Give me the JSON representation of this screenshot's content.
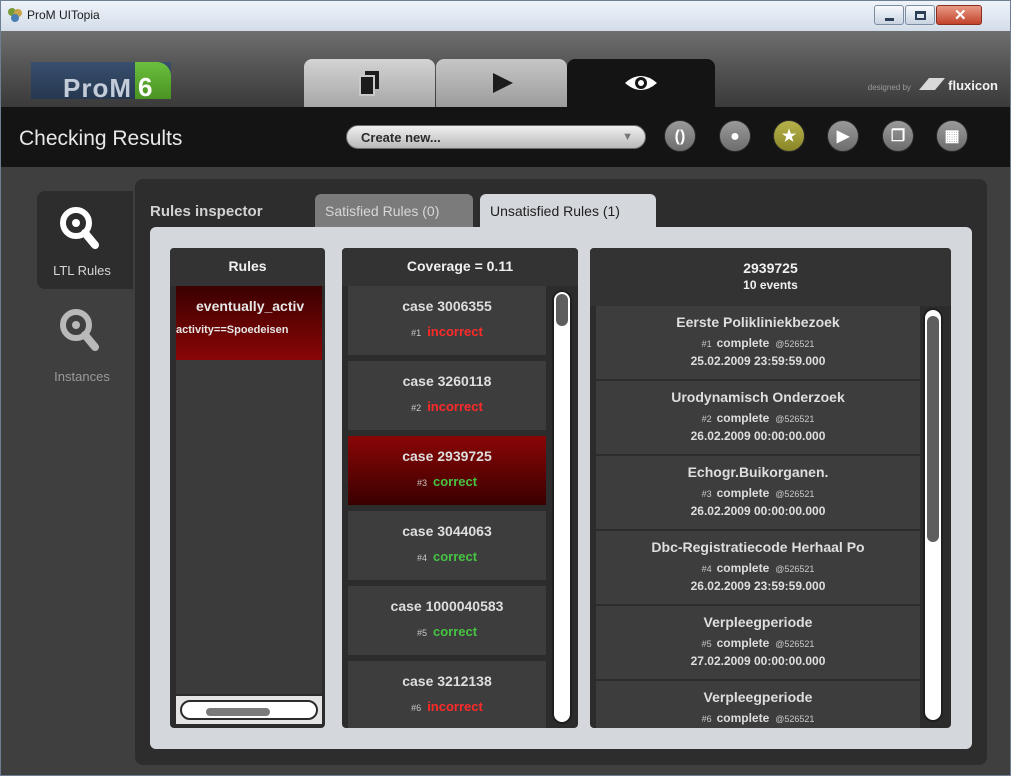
{
  "window": {
    "title": "ProM UITopia"
  },
  "brand": {
    "logo_word": "ProM",
    "logo_version": "6",
    "designed_by": "designed by",
    "vendor": "fluxicon"
  },
  "header": {
    "title": "Checking Results",
    "create_select": "Create new..."
  },
  "sidebar": {
    "items": [
      {
        "label": "LTL Rules"
      },
      {
        "label": "Instances"
      }
    ]
  },
  "inspector": {
    "title": "Rules inspector",
    "tabs": [
      {
        "label": "Satisfied Rules (0)"
      },
      {
        "label": "Unsatisfied Rules (1)"
      }
    ]
  },
  "rules_panel": {
    "header": "Rules",
    "items": [
      {
        "line1": "eventually_activ",
        "line2": "activity==Spoedeisen"
      }
    ]
  },
  "cases_panel": {
    "header": "Coverage = 0.11",
    "items": [
      {
        "name": "case 3006355",
        "index": "#1",
        "status": "incorrect"
      },
      {
        "name": "case 3260118",
        "index": "#2",
        "status": "incorrect"
      },
      {
        "name": "case 2939725",
        "index": "#3",
        "status": "correct"
      },
      {
        "name": "case 3044063",
        "index": "#4",
        "status": "correct"
      },
      {
        "name": "case 1000040583",
        "index": "#5",
        "status": "correct"
      },
      {
        "name": "case 3212138",
        "index": "#6",
        "status": "incorrect"
      }
    ]
  },
  "events_panel": {
    "header": "2939725",
    "subheader": "10 events",
    "items": [
      {
        "name": "Eerste Polikliniekbezoek",
        "index": "#1",
        "lifecycle": "complete",
        "resource": "@526521",
        "date": "25.02.2009 23:59:59.000"
      },
      {
        "name": "Urodynamisch Onderzoek",
        "index": "#2",
        "lifecycle": "complete",
        "resource": "@526521",
        "date": "26.02.2009 00:00:00.000"
      },
      {
        "name": "Echogr.Buikorganen.",
        "index": "#3",
        "lifecycle": "complete",
        "resource": "@526521",
        "date": "26.02.2009 00:00:00.000"
      },
      {
        "name": "Dbc-Registratiecode Herhaal Po",
        "index": "#4",
        "lifecycle": "complete",
        "resource": "@526521",
        "date": "26.02.2009 23:59:59.000"
      },
      {
        "name": "Verpleegperiode",
        "index": "#5",
        "lifecycle": "complete",
        "resource": "@526521",
        "date": "27.02.2009 00:00:00.000"
      },
      {
        "name": "Verpleegperiode",
        "index": "#6",
        "lifecycle": "complete",
        "resource": "@526521",
        "date": ""
      }
    ]
  },
  "colors": {
    "correct": "#46c442",
    "incorrect": "#ff2a2a",
    "selected": "#8a0606",
    "accent": "#6bbf3d"
  },
  "icons": [
    "prom-app-icon",
    "minimize-icon",
    "maximize-icon",
    "close-icon",
    "copy-tab-icon",
    "play-tab-icon",
    "eye-tab-icon",
    "fluxicon-logo-icon",
    "brackets-icon",
    "drop-icon",
    "star-icon",
    "play-icon",
    "copy-icon",
    "grid-icon",
    "magnifier-icon"
  ]
}
